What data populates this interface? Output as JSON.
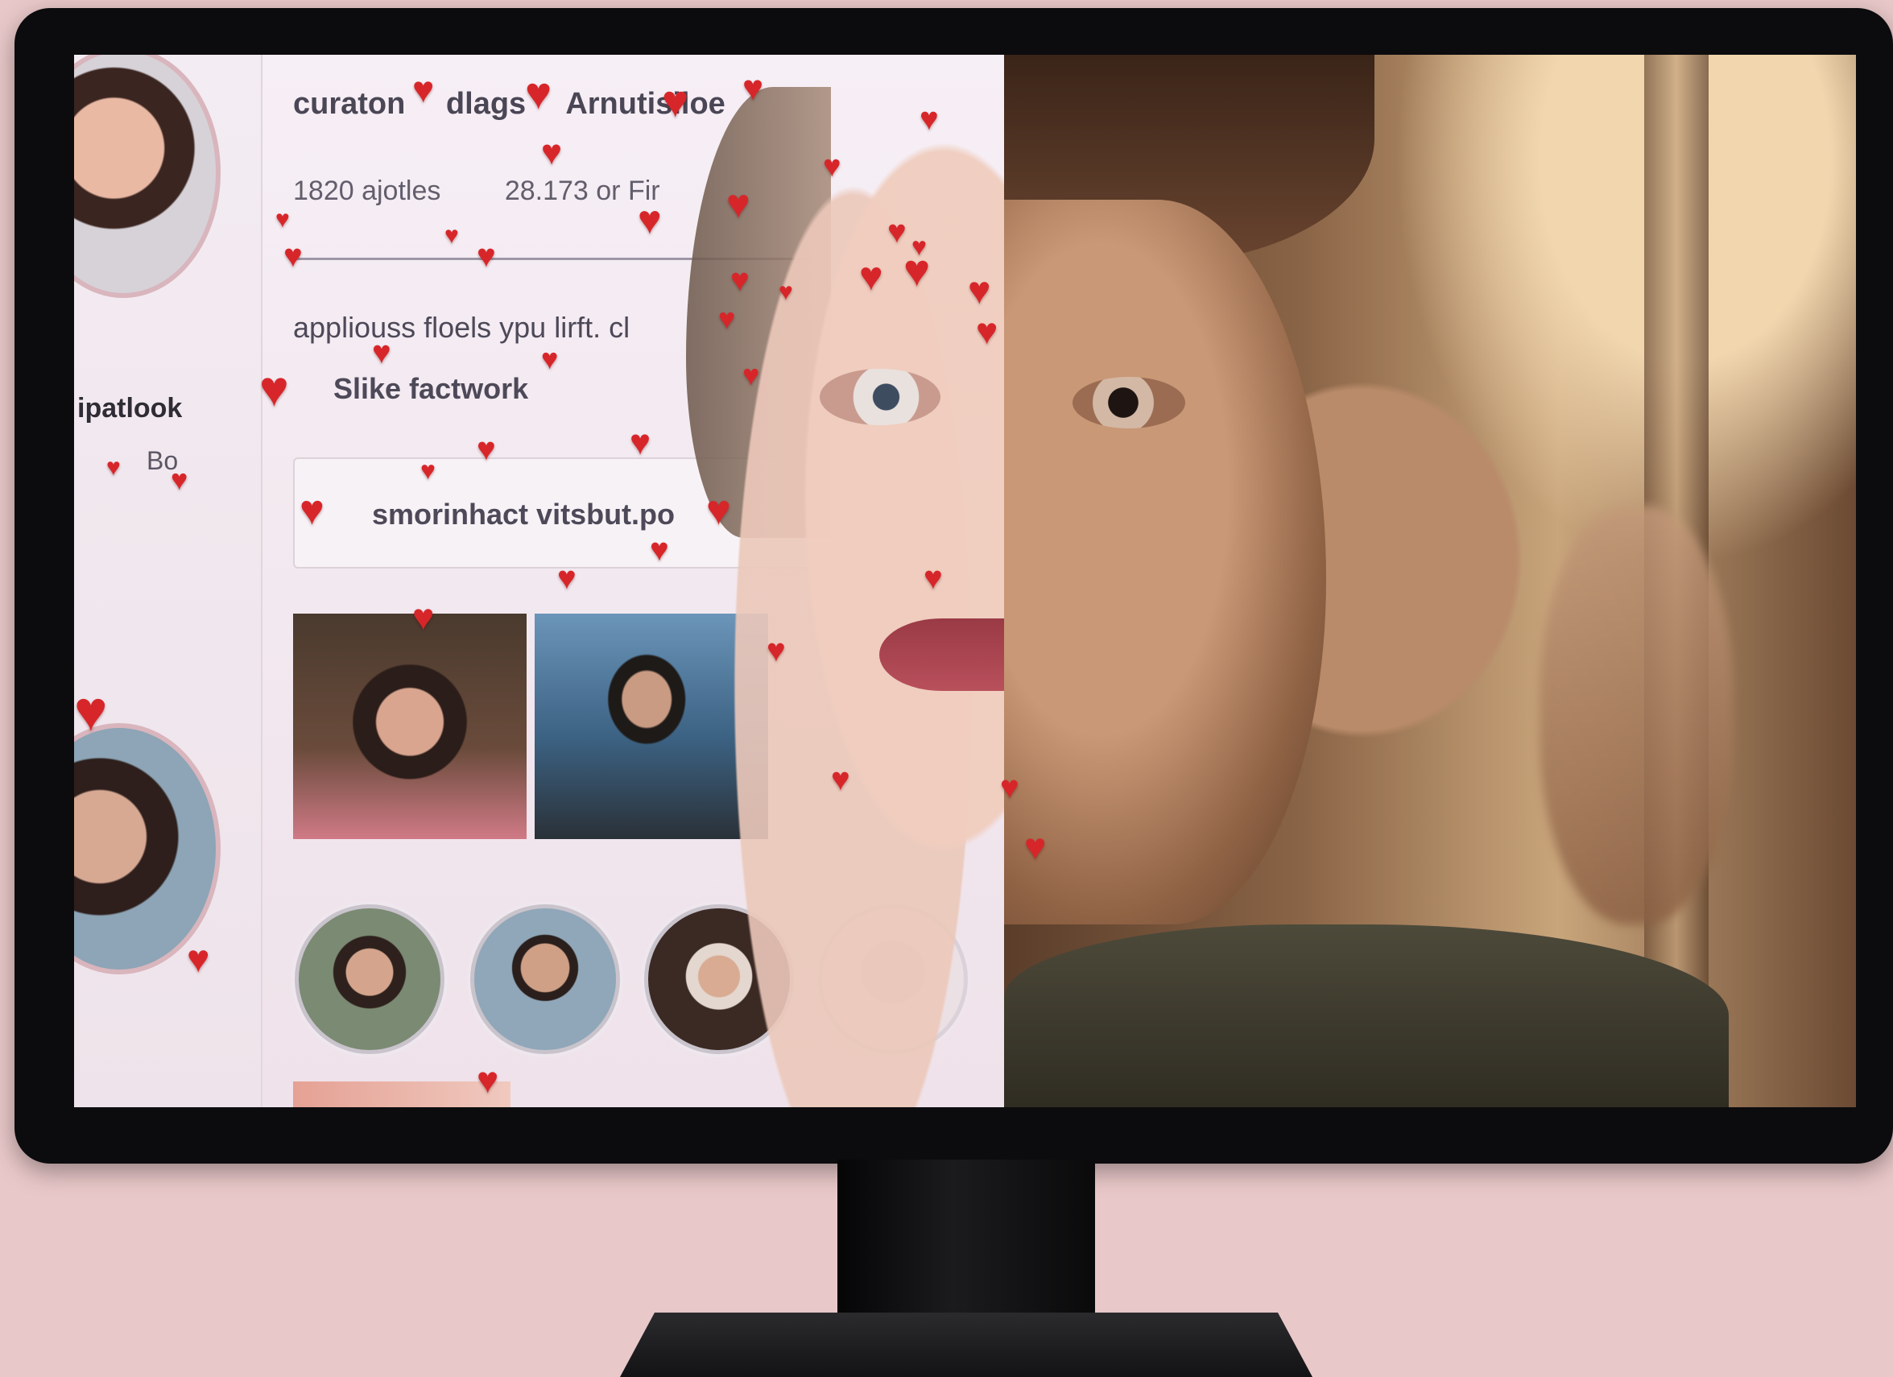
{
  "sidebar": {
    "name": "ipatlook",
    "sub": "Bo"
  },
  "header": {
    "items": [
      "curaton",
      "dlags",
      "Arnutisiloe"
    ]
  },
  "stats": {
    "first": "1820 ajotles",
    "second": "28.173 or Fir"
  },
  "description": "appliouss floels ypu lirft. cl",
  "action_label": "Slike factwork",
  "search": {
    "text": "smorinhact vitsbut.po"
  },
  "colors": {
    "heart": "#d7262a",
    "background": "#e9c8c9"
  },
  "icons": {
    "heart": "heart-icon"
  }
}
